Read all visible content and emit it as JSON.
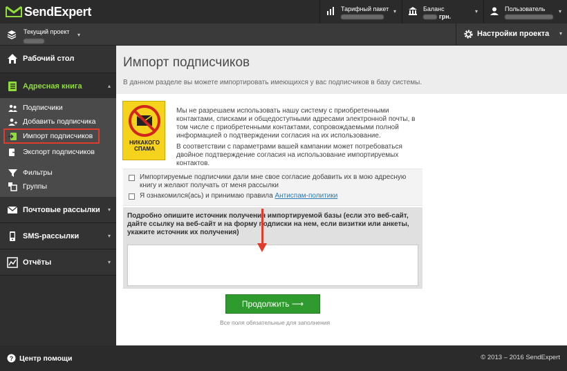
{
  "brand": {
    "name": "SendExpert",
    "accent": "#8fdc3a"
  },
  "topbar": {
    "tariff": {
      "label": "Тарифный пакет",
      "icon": "bars-icon"
    },
    "balance": {
      "label": "Баланс",
      "value": "грн.",
      "icon": "bank-icon"
    },
    "user": {
      "label": "Пользователь",
      "icon": "user-icon"
    }
  },
  "project": {
    "label": "Текущий проект",
    "settings_label": "Настройки проекта"
  },
  "sidebar": {
    "dashboard": "Рабочий стол",
    "address_book": "Адресная книга",
    "sub_items": [
      "Подписчики",
      "Добавить подписчика",
      "Импорт подписчиков",
      "Экспорт подписчиков",
      "Фильтры",
      "Группы"
    ],
    "mailings": "Почтовые рассылки",
    "sms": "SMS-рассылки",
    "reports": "Отчёты"
  },
  "page": {
    "title": "Импорт подписчиков",
    "description": "В данном разделе вы можете импортировать имеющихся у вас подписчиков в базу системы.",
    "warning_badge": "НИКАКОГО СПАМА",
    "intro_1": "Мы не разрешаем использовать нашу систему с приобретенными контактами, списками и общедоступными адресами электронной почты, в том числе с приобретенными контактами, сопровождаемыми полной информацией о подтверждении согласия на их использование.",
    "intro_2": "В соответствии с параметрами вашей кампании может потребоваться двойное подтверждение согласия на использование импортируемых контактов.",
    "consent_1": "Импортируемые подписчики дали мне свое согласие добавить их в мою адресную книгу и желают получать от меня рассылки",
    "consent_2_prefix": "Я ознакомился(ась) и принимаю правила",
    "consent_2_link": "Антиспам-политики",
    "source_label": "Подробно опишите источник получения импортируемой базы (если это веб-сайт, дайте ссылку на веб-сайт и на форму подписки на нем, если визитки или анкеты, укажите источник их получения)",
    "source_value": "",
    "continue_button": "Продолжить ⟶",
    "required_note": "Все поля обязательные для заполнения"
  },
  "footer": {
    "help": "Центр помощи",
    "copyright": "© 2013 – 2016 SendExpert"
  }
}
